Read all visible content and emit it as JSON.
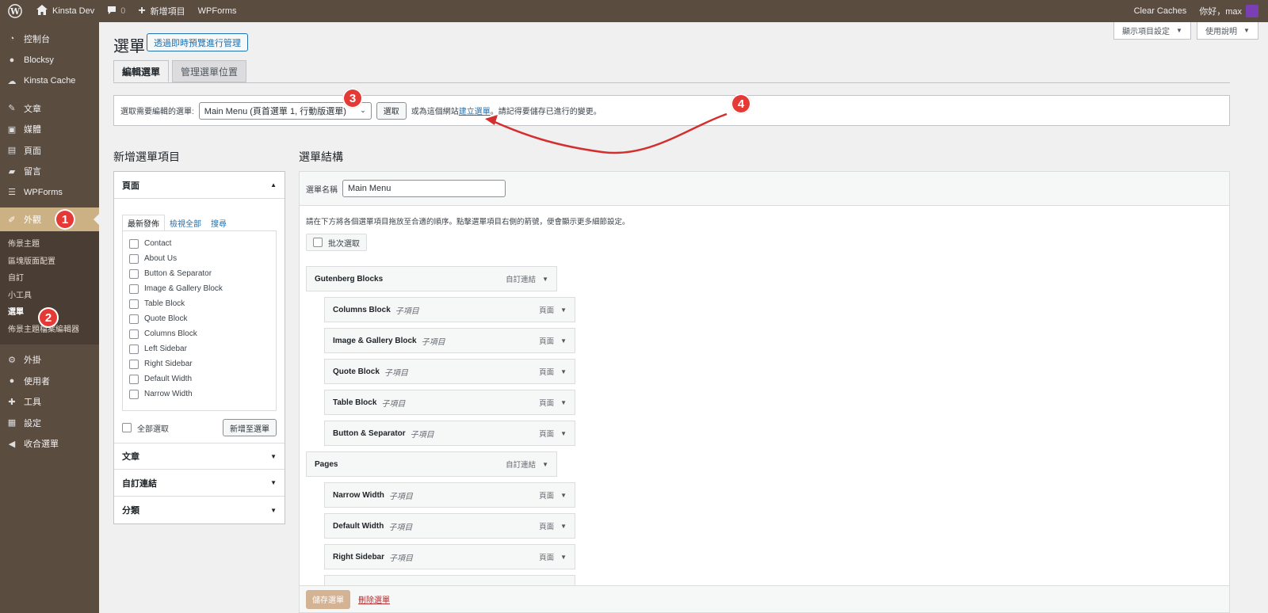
{
  "admin_bar": {
    "site": "Kinsta Dev",
    "comments": "0",
    "new": "新增項目",
    "wpforms": "WPForms",
    "clear_caches": "Clear Caches",
    "greeting": "你好，max"
  },
  "sidebar": {
    "items": [
      {
        "label": "控制台",
        "icon": "dashboard-icon"
      },
      {
        "label": "Blocksy",
        "icon": "blocksy-icon"
      },
      {
        "label": "Kinsta Cache",
        "icon": "cloud-icon"
      },
      {
        "label": "文章",
        "icon": "pin-icon"
      },
      {
        "label": "媒體",
        "icon": "media-icon"
      },
      {
        "label": "頁面",
        "icon": "page-icon"
      },
      {
        "label": "留言",
        "icon": "comment-icon"
      },
      {
        "label": "WPForms",
        "icon": "wpforms-icon"
      },
      {
        "label": "外觀",
        "icon": "brush-icon"
      }
    ],
    "submenu": [
      "佈景主題",
      "區塊版面配置",
      "自訂",
      "小工具",
      "選單",
      "佈景主題檔案編輯器"
    ],
    "items_after": [
      {
        "label": "外掛",
        "icon": "plugin-icon"
      },
      {
        "label": "使用者",
        "icon": "user-icon"
      },
      {
        "label": "工具",
        "icon": "wrench-icon"
      },
      {
        "label": "設定",
        "icon": "settings-icon"
      },
      {
        "label": "收合選單",
        "icon": "collapse-icon"
      }
    ]
  },
  "badges": [
    "1",
    "2",
    "3",
    "4"
  ],
  "screen_options": {
    "display": "顯示項目設定",
    "help": "使用說明"
  },
  "page": {
    "title": "選單",
    "live_preview": "透過即時預覽進行管理",
    "tabs": [
      "編輯選單",
      "管理選單位置"
    ]
  },
  "manage": {
    "label": "選取需要編輯的選單:",
    "selected": "Main Menu (頁首選單 1, 行動版選單)",
    "select_btn": "選取",
    "or_text": "或為這個網站",
    "create_link": "建立選單",
    "remember": "。請記得要儲存已進行的變更。"
  },
  "add_items": {
    "heading": "新增選單項目",
    "pages_section": "頁面",
    "inner_tabs": [
      "最新發佈",
      "檢視全部",
      "搜尋"
    ],
    "pages": [
      "Contact",
      "About Us",
      "Button & Separator",
      "Image & Gallery Block",
      "Table Block",
      "Quote Block",
      "Columns Block",
      "Left Sidebar",
      "Right Sidebar",
      "Default Width",
      "Narrow Width"
    ],
    "select_all": "全部選取",
    "add_btn": "新增至選單",
    "other_sections": [
      "文章",
      "自訂連結",
      "分類"
    ]
  },
  "structure": {
    "heading": "選單結構",
    "name_label": "選單名稱",
    "name_value": "Main Menu",
    "instructions": "請在下方將各個選單項目拖放至合適的順序。點擊選單項目右側的箭號，便會顯示更多細節設定。",
    "bulk_select": "批次選取",
    "items": [
      {
        "title": "Gutenberg Blocks",
        "sub": "",
        "type": "自訂連結",
        "level": 0
      },
      {
        "title": "Columns Block",
        "sub": "子項目",
        "type": "頁面",
        "level": 1
      },
      {
        "title": "Image & Gallery Block",
        "sub": "子項目",
        "type": "頁面",
        "level": 1
      },
      {
        "title": "Quote Block",
        "sub": "子項目",
        "type": "頁面",
        "level": 1
      },
      {
        "title": "Table Block",
        "sub": "子項目",
        "type": "頁面",
        "level": 1
      },
      {
        "title": "Button & Separator",
        "sub": "子項目",
        "type": "頁面",
        "level": 1
      },
      {
        "title": "Pages",
        "sub": "",
        "type": "自訂連結",
        "level": 0
      },
      {
        "title": "Narrow Width",
        "sub": "子項目",
        "type": "頁面",
        "level": 1
      },
      {
        "title": "Default Width",
        "sub": "子項目",
        "type": "頁面",
        "level": 1
      },
      {
        "title": "Right Sidebar",
        "sub": "子項目",
        "type": "頁面",
        "level": 1
      }
    ],
    "save_btn": "儲存選單",
    "delete_link": "刪除選單"
  },
  "colors": {
    "sidebar_bg": "#5b4c40",
    "active_bg": "#ccb184",
    "badge": "#e53935",
    "arrow": "#d32f2f",
    "link": "#2271b1"
  }
}
